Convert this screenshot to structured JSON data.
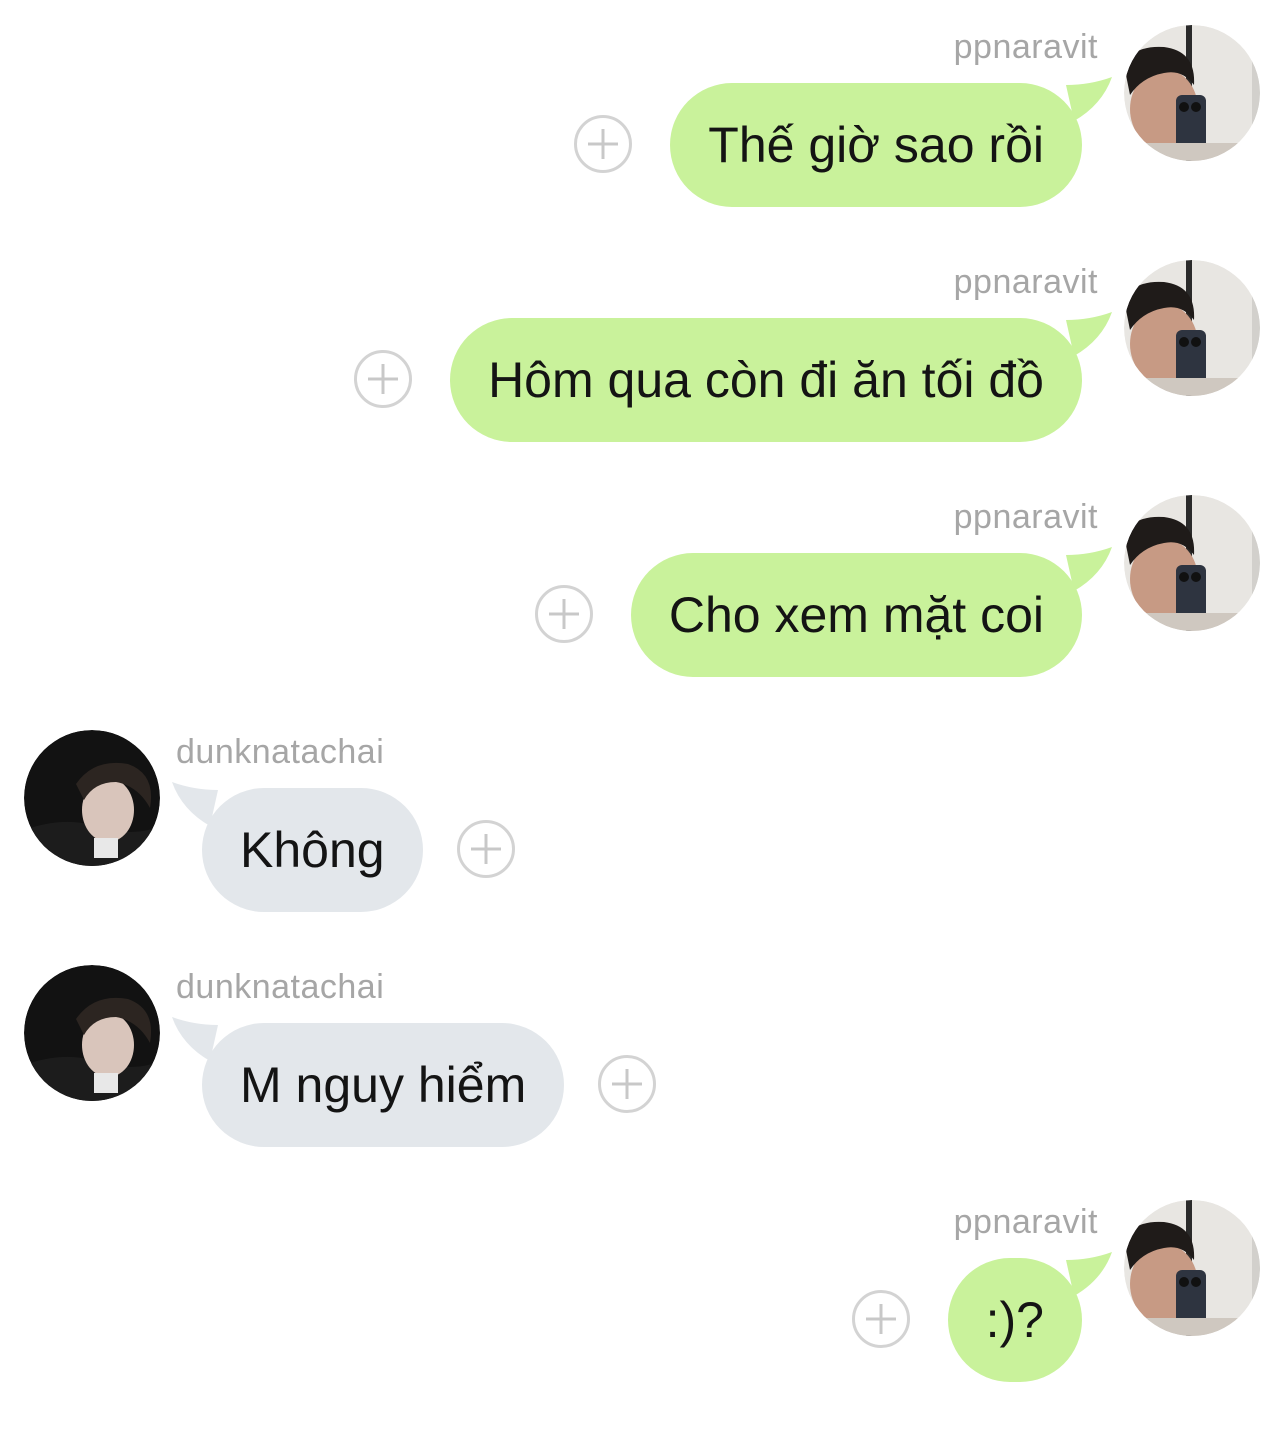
{
  "colors": {
    "outgoing_bubble": "#c9f29b",
    "incoming_bubble": "#e3e7eb",
    "username_text": "#a6a6a6",
    "add_button_border": "#d3d3d3"
  },
  "icons": {
    "add_reaction": "plus-circle-icon"
  },
  "messages": [
    {
      "direction": "out",
      "username": "ppnaravit",
      "text": "Thế giờ sao rồi"
    },
    {
      "direction": "out",
      "username": "ppnaravit",
      "text": "Hôm qua còn đi ăn tối đồ"
    },
    {
      "direction": "out",
      "username": "ppnaravit",
      "text": "Cho xem mặt coi"
    },
    {
      "direction": "in",
      "username": "dunknatachai",
      "text": "Không"
    },
    {
      "direction": "in",
      "username": "dunknatachai",
      "text": "M nguy hiểm"
    },
    {
      "direction": "out",
      "username": "ppnaravit",
      "text": ":)?"
    }
  ]
}
